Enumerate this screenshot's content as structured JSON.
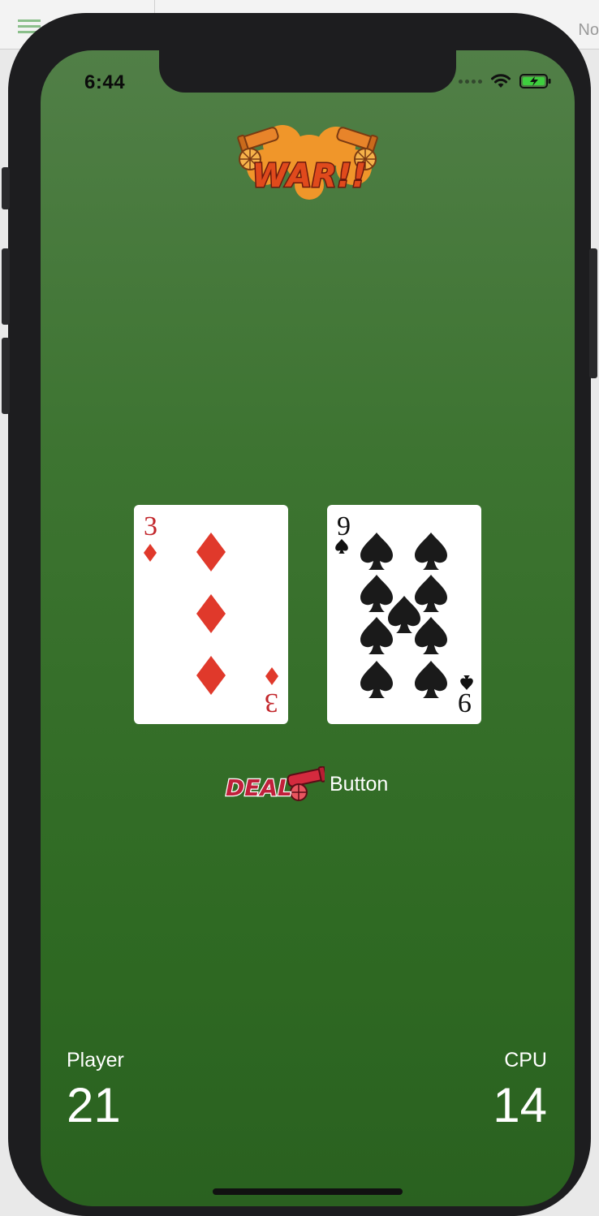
{
  "editor": {
    "nav_text": "No"
  },
  "status_bar": {
    "time": "6:44"
  },
  "logo": {
    "text": "WAR!!"
  },
  "cards": {
    "player": {
      "rank": "3",
      "suit": "diamonds",
      "color": "#c2262b"
    },
    "cpu": {
      "rank": "9",
      "suit": "spades",
      "color": "#111111"
    }
  },
  "deal": {
    "image_text": "DEAL",
    "label": "Button"
  },
  "scores": {
    "player_label": "Player",
    "player_value": "21",
    "cpu_label": "CPU",
    "cpu_value": "14"
  },
  "colors": {
    "felt_top": "#517f47",
    "felt_bottom": "#2a6120",
    "logo_orange": "#f0962a",
    "logo_red": "#d93a1c",
    "deal_red": "#c0203a"
  }
}
